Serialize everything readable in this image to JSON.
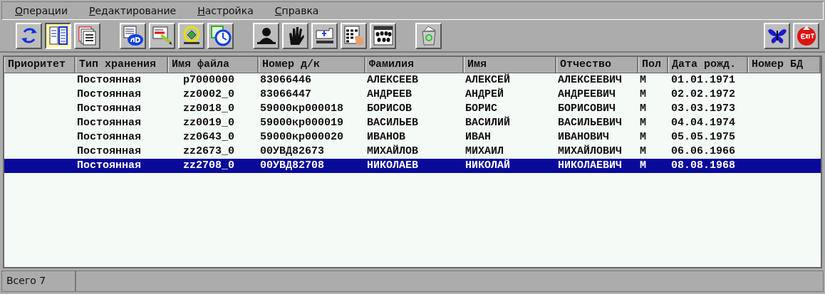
{
  "menu": [
    {
      "label": "Операции"
    },
    {
      "label": "Редактирование"
    },
    {
      "label": "Настройка"
    },
    {
      "label": "Справка"
    }
  ],
  "toolbar": {
    "groups": [
      [
        {
          "kind": "refresh",
          "selected": false
        },
        {
          "kind": "list",
          "selected": true
        },
        {
          "kind": "cards",
          "selected": false
        }
      ],
      [
        {
          "kind": "text",
          "selected": false
        },
        {
          "kind": "edit",
          "selected": false
        },
        {
          "kind": "gear",
          "selected": false
        },
        {
          "kind": "clock",
          "selected": false
        }
      ],
      [
        {
          "kind": "person",
          "selected": false
        },
        {
          "kind": "hand",
          "selected": false
        },
        {
          "kind": "scan",
          "selected": false
        },
        {
          "kind": "form",
          "selected": false
        },
        {
          "kind": "prints",
          "selected": false
        }
      ],
      [
        {
          "kind": "bin",
          "selected": false
        }
      ]
    ],
    "right": [
      {
        "kind": "butterfly",
        "selected": false
      },
      {
        "kind": "exit",
        "selected": false
      }
    ]
  },
  "table": {
    "columns": [
      "Приоритет",
      "Тип хранения",
      "Имя файла",
      "Номер д/к",
      "Фамилия",
      "Имя",
      "Отчество",
      "Пол",
      "Дата рожд.",
      "Номер БД"
    ],
    "rows": [
      {
        "cells": [
          "",
          "Постоянная",
          "p7000000",
          "83066446",
          "АЛЕКСЕЕВ",
          "АЛЕКСЕЙ",
          "АЛЕКСЕЕВИЧ",
          "М",
          "01.01.1971",
          ""
        ],
        "selected": false
      },
      {
        "cells": [
          "",
          "Постоянная",
          "zz0002_0",
          "83066447",
          "АНДРЕЕВ",
          "АНДРЕЙ",
          "АНДРЕЕВИЧ",
          "М",
          "02.02.1972",
          ""
        ],
        "selected": false
      },
      {
        "cells": [
          "",
          "Постоянная",
          "zz0018_0",
          "59000кр000018",
          "БОРИСОВ",
          "БОРИС",
          "БОРИСОВИЧ",
          "М",
          "03.03.1973",
          ""
        ],
        "selected": false
      },
      {
        "cells": [
          "",
          "Постоянная",
          "zz0019_0",
          "59000кр000019",
          "ВАСИЛЬЕВ",
          "ВАСИЛИЙ",
          "ВАСИЛЬЕВИЧ",
          "М",
          "04.04.1974",
          ""
        ],
        "selected": false
      },
      {
        "cells": [
          "",
          "Постоянная",
          "zz0643_0",
          "59000кр000020",
          "ИВАНОВ",
          "ИВАН",
          "ИВАНОВИЧ",
          "М",
          "05.05.1975",
          ""
        ],
        "selected": false
      },
      {
        "cells": [
          "",
          "Постоянная",
          "zz2673_0",
          "00УВД82673",
          "МИХАЙЛОВ",
          "МИХАИЛ",
          "МИХАЙЛОВИЧ",
          "М",
          "06.06.1966",
          ""
        ],
        "selected": false
      },
      {
        "cells": [
          "",
          "Постоянная",
          "zz2708_0",
          "00УВД82708",
          "НИКОЛАЕВ",
          "НИКОЛАЙ",
          "НИКОЛАЕВИЧ",
          "М",
          "08.08.1968",
          ""
        ],
        "selected": true
      }
    ]
  },
  "status_bar": {
    "total": "Всего 7"
  }
}
